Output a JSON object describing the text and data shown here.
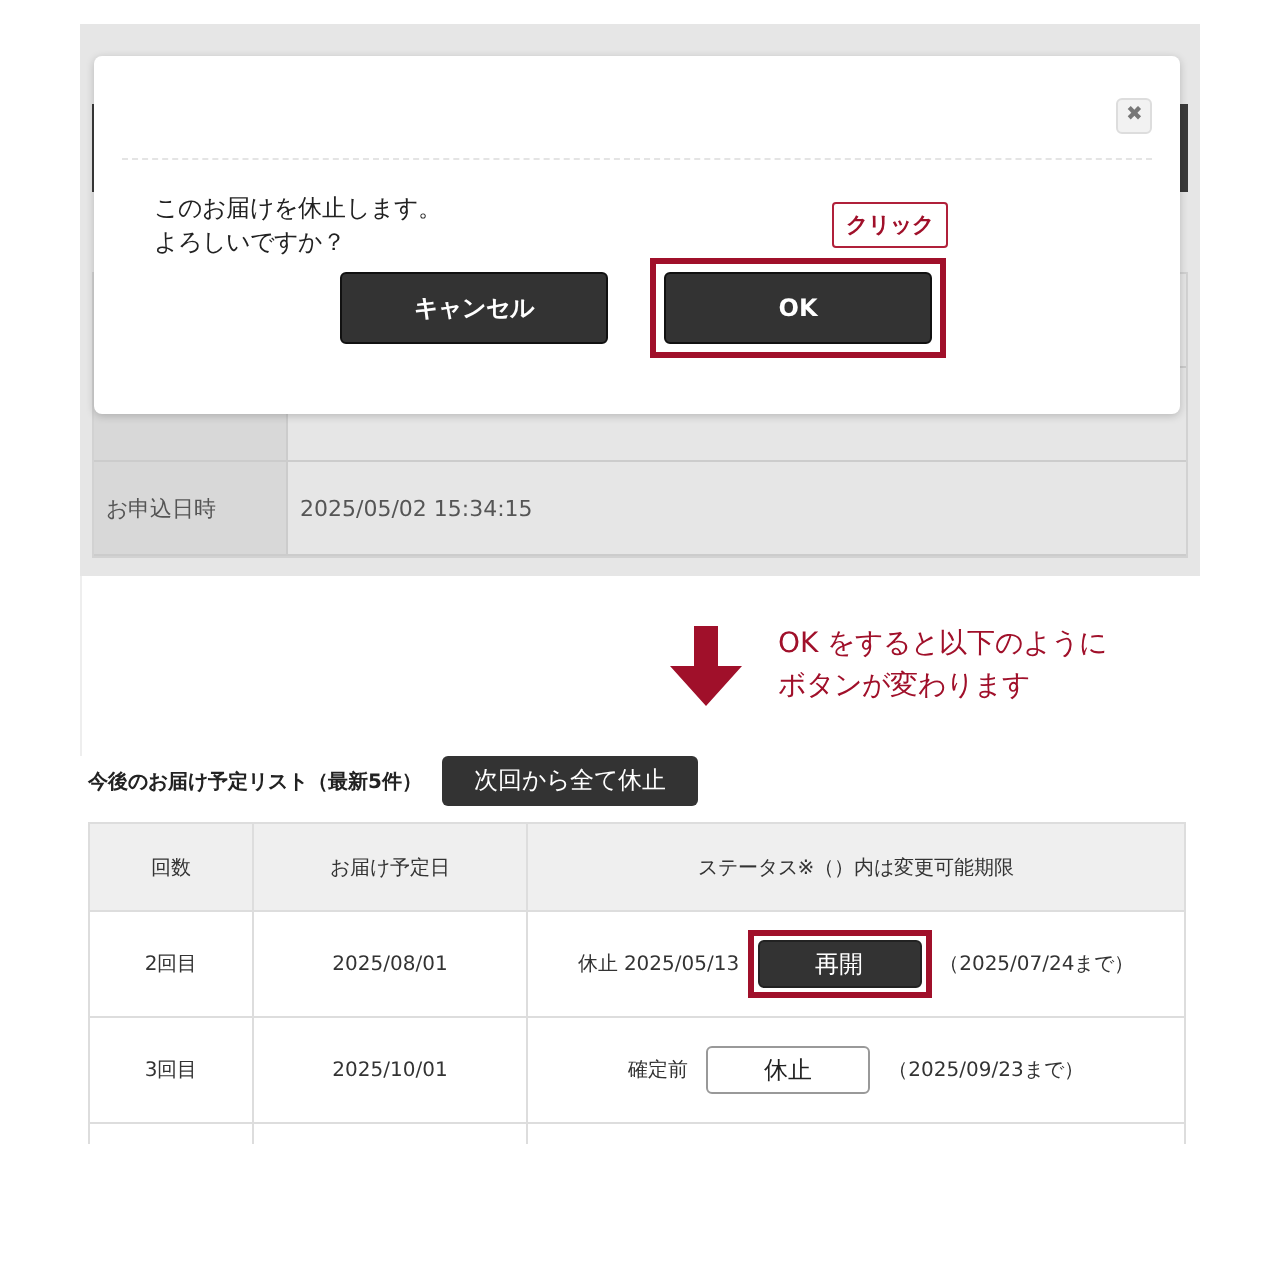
{
  "detail_rows": [
    {
      "label": "お申込日時",
      "value": "2025/05/02 15:34:15"
    }
  ],
  "dialog": {
    "close": "✖",
    "message": [
      "このお届けを休止します。",
      "よろしいですか？"
    ],
    "buttons": [
      {
        "label": "キャンセル",
        "highlighted": false
      },
      {
        "label": "OK",
        "highlighted": true
      }
    ],
    "callout": "クリック"
  },
  "note": [
    "OK をすると以下のように",
    "ボタンが変わります"
  ],
  "schedule": {
    "title": "今後のお届け予定リスト（最新5件）",
    "pause_all": "次回から全て休止",
    "columns": [
      "回数",
      "お届け予定日",
      "ステータス※（）内は変更可能期限"
    ],
    "rows": [
      {
        "count": "2回目",
        "date": "2025/08/01",
        "status": "休止 2025/05/13",
        "button": {
          "kind": "resume",
          "label": "再開",
          "highlighted": true
        },
        "deadline": "（2025/07/24まで）"
      },
      {
        "count": "3回目",
        "date": "2025/10/01",
        "status": "確定前",
        "button": {
          "kind": "pause",
          "label": "休止",
          "highlighted": false
        },
        "deadline": "（2025/09/23まで）"
      }
    ]
  }
}
